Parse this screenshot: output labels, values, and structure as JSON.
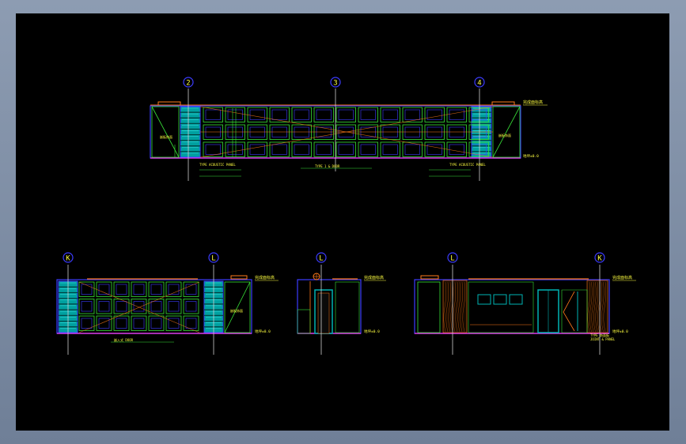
{
  "colors": {
    "background": "#000000",
    "frame": "#7f8fa6",
    "outline": "#3c3cff",
    "panel": "#00b3b3",
    "grid_green": "#38e038",
    "accent_orange": "#ff7a1a",
    "text_yellow": "#ffff40",
    "magenta": "#ff40ff",
    "axis": "#cfcfcf"
  },
  "grid_markers": {
    "top": [
      "2",
      "3",
      "4"
    ],
    "bottom_left": [
      "K",
      "L"
    ],
    "bottom_mid": [
      "L"
    ],
    "bottom_right": [
      "L",
      "K"
    ]
  },
  "labels": {
    "top_level": "完成面标高",
    "floor_level": "地坪±0.0",
    "panel_note_left": "TYPE ACOUSTIC PANEL",
    "panel_note_right": "TYPE ACOUSTIC PANEL",
    "center_note": "TYPE 1 & DOOR",
    "side_note": "嵌板饰面",
    "bottom_note": "嵌入式 DOOR",
    "finish_note_1": "TYPE 饰面板",
    "finish_note_2": "JOINT & PANEL"
  }
}
